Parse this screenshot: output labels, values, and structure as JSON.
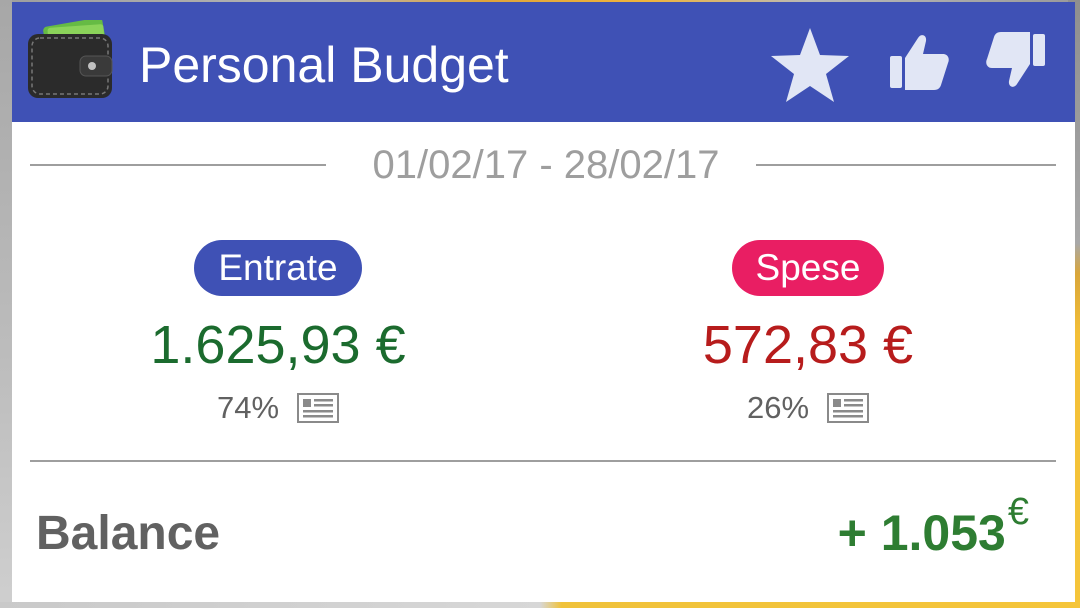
{
  "app": {
    "title": "Personal Budget"
  },
  "icons": {
    "wallet": "wallet-icon",
    "star": "star-icon",
    "like": "thumbs-up-icon",
    "dislike": "thumbs-down-icon",
    "list": "list-icon"
  },
  "period": {
    "range": "01/02/17 - 28/02/17"
  },
  "income": {
    "label": "Entrate",
    "amount": "1.625,93 €",
    "percent": "74%"
  },
  "expense": {
    "label": "Spese",
    "amount": "572,83 €",
    "percent": "26%"
  },
  "balance": {
    "label": "Balance",
    "value": "+ 1.053",
    "currency": "€"
  },
  "colors": {
    "header": "#3f51b5",
    "income_pill": "#3f51b5",
    "expense_pill": "#e91e63",
    "income_amount": "#1b6b2e",
    "expense_amount": "#b71c1c",
    "balance_value": "#2e7d32"
  }
}
